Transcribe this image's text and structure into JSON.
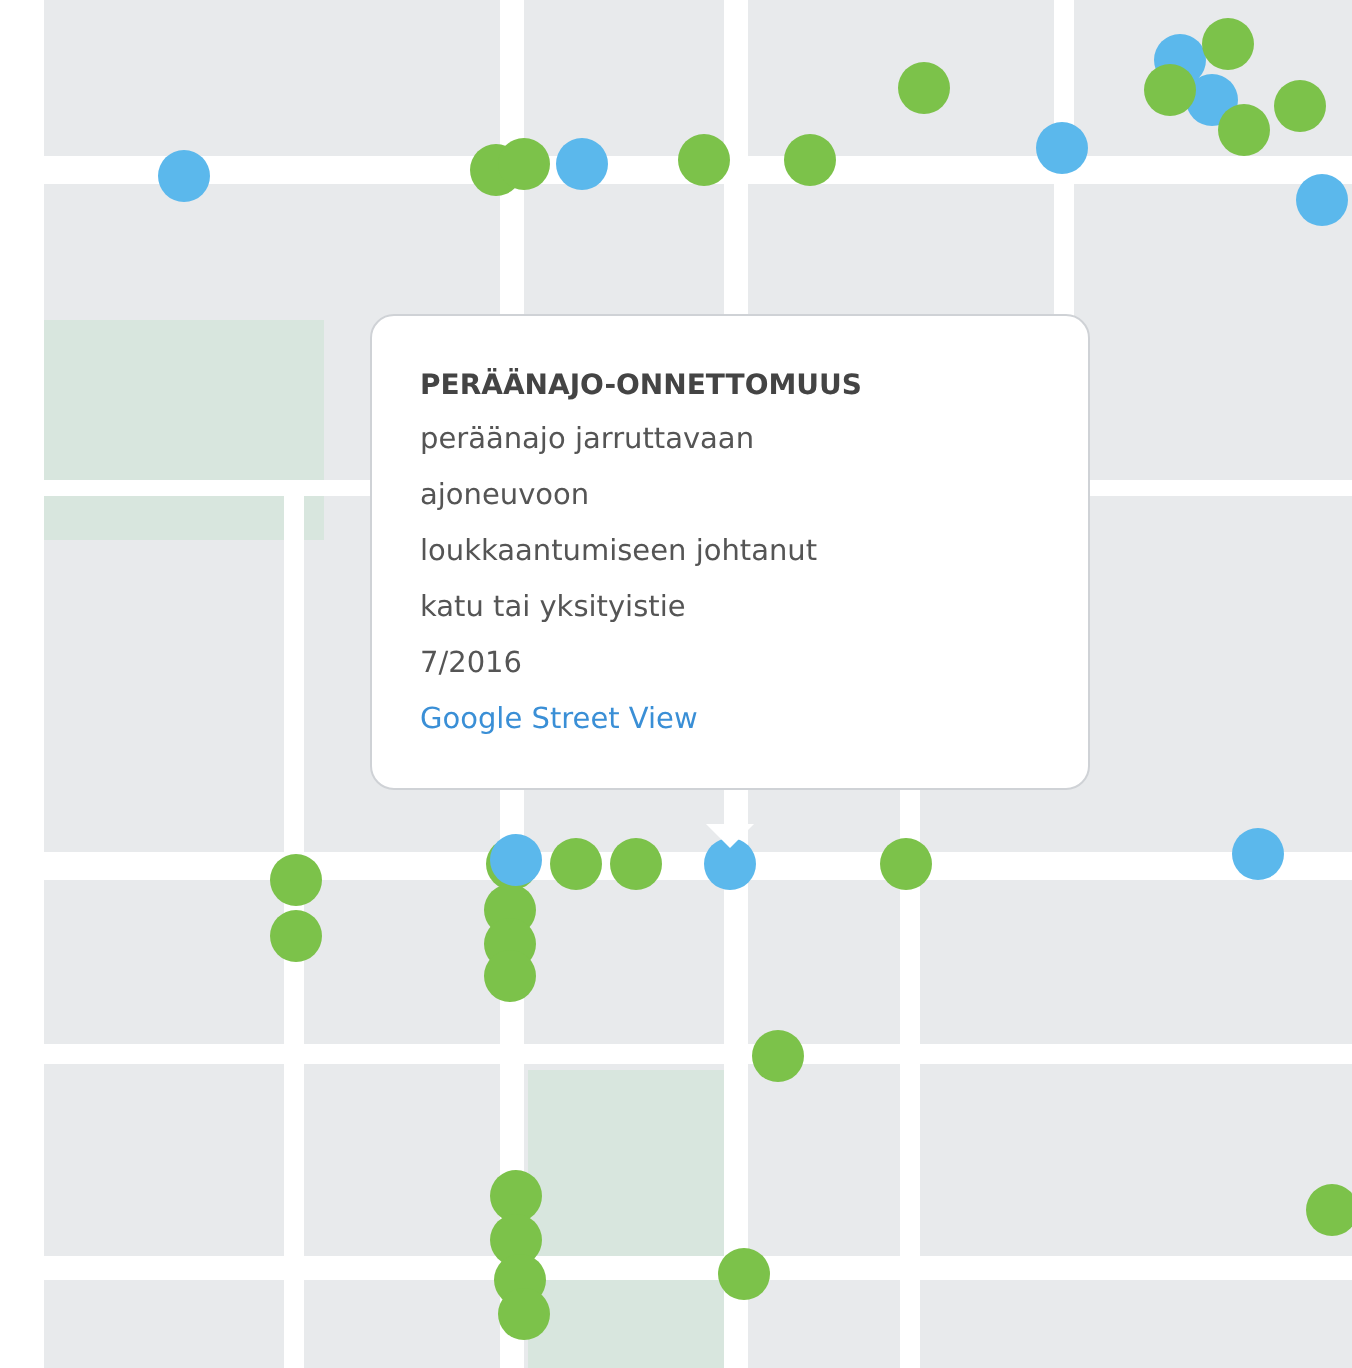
{
  "markers": [
    {
      "color": "#5bb8ec"
    },
    {
      "color": "#5bb8ec"
    },
    {
      "color": "#5bb8ec"
    },
    {
      "color": "#5bb8ec"
    },
    {
      "color": "#5bb8ec"
    },
    {
      "color": "#5bb8ec"
    },
    {
      "color": "#5bb8ec"
    },
    {
      "color": "#5bb8ec"
    },
    {
      "color": "#7cc24a"
    },
    {
      "color": "#7cc24a"
    },
    {
      "color": "#7cc24a"
    },
    {
      "color": "#7cc24a"
    },
    {
      "color": "#7cc24a"
    },
    {
      "color": "#7cc24a"
    },
    {
      "color": "#7cc24a"
    },
    {
      "color": "#7cc24a"
    },
    {
      "color": "#7cc24a"
    },
    {
      "color": "#7cc24a"
    },
    {
      "color": "#7cc24a"
    },
    {
      "color": "#7cc24a"
    },
    {
      "color": "#7cc24a"
    },
    {
      "color": "#7cc24a"
    },
    {
      "color": "#7cc24a"
    },
    {
      "color": "#7cc24a"
    },
    {
      "color": "#7cc24a"
    },
    {
      "color": "#7cc24a"
    },
    {
      "color": "#7cc24a"
    },
    {
      "color": "#7cc24a"
    },
    {
      "color": "#7cc24a"
    },
    {
      "color": "#7cc24a"
    },
    {
      "color": "#7cc24a"
    },
    {
      "color": "#7cc24a"
    },
    {
      "color": "#7cc24a"
    },
    {
      "color": "#5bb8ec"
    }
  ],
  "popup": {
    "title": "PERÄÄNAJO-ONNETTOMUUS",
    "lines": [
      "peräänajo jarruttavaan",
      "ajoneuvoon",
      "loukkaantumiseen johtanut",
      "katu tai yksityistie",
      "7/2016"
    ],
    "link": "Google Street View"
  }
}
